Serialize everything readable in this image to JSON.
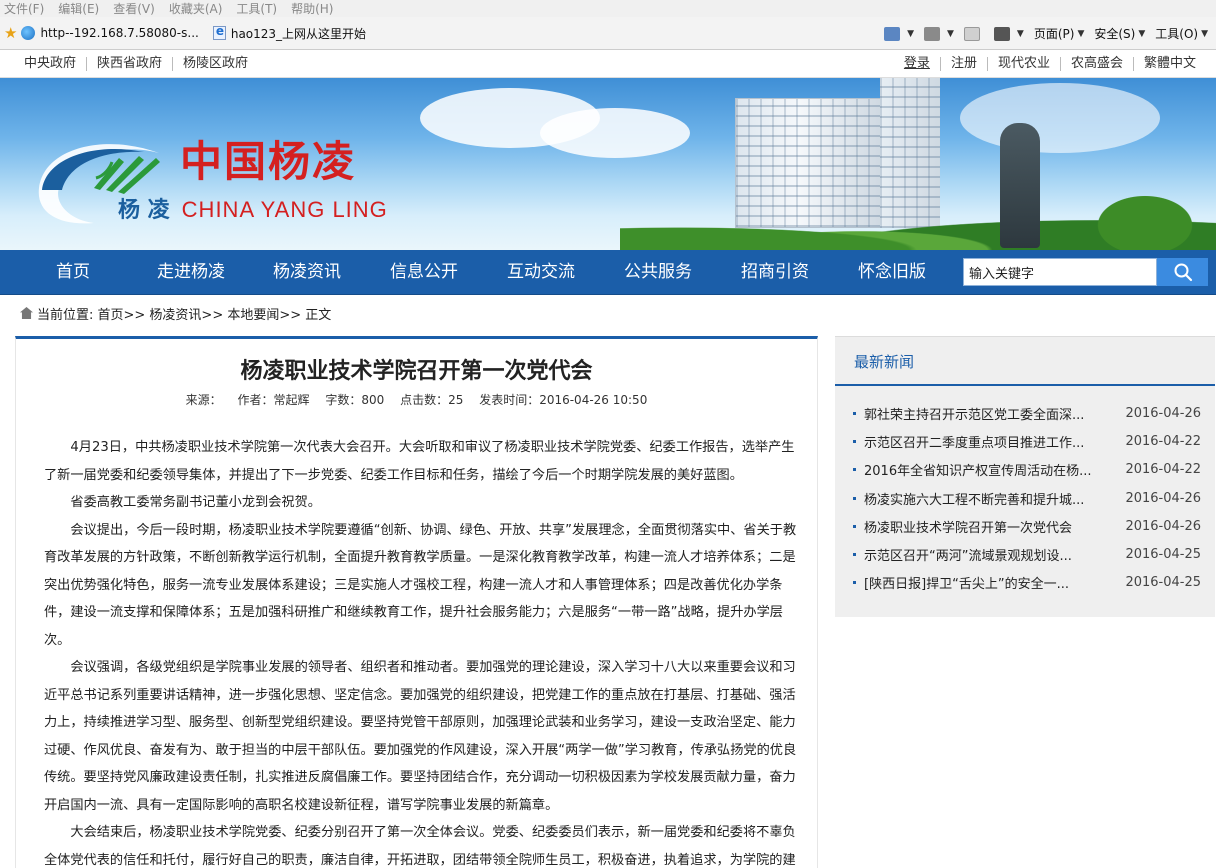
{
  "browser": {
    "menu": [
      "文件(F)",
      "编辑(E)",
      "查看(V)",
      "收藏夹(A)",
      "工具(T)",
      "帮助(H)"
    ],
    "favorites": [
      "http--192.168.7.58080-s...",
      "hao123_上网从这里开始"
    ],
    "tools": [
      "页面(P)",
      "安全(S)",
      "工具(O)"
    ]
  },
  "toplinks": {
    "left": [
      "中央政府",
      "陕西省政府",
      "杨陵区政府"
    ],
    "right": [
      "登录",
      "注册",
      "现代农业",
      "农高盛会",
      "繁體中文"
    ]
  },
  "logo": {
    "cn": "中国杨凌",
    "sub_cn": "杨 凌",
    "sub_en": "CHINA YANG LING"
  },
  "nav": [
    "首页",
    "走进杨凌",
    "杨凌资讯",
    "信息公开",
    "互动交流",
    "公共服务",
    "招商引资",
    "怀念旧版"
  ],
  "search": {
    "placeholder": "输入关键字"
  },
  "breadcrumb": "当前位置: 首页>> 杨凌资讯>> 本地要闻>> 正文",
  "article": {
    "title": "杨凌职业技术学院召开第一次党代会",
    "meta": [
      "来源：",
      "作者：常起辉",
      "字数：800",
      "点击数：25",
      "发表时间：2016-04-26 10:50"
    ],
    "paragraphs": [
      "4月23日，中共杨凌职业技术学院第一次代表大会召开。大会听取和审议了杨凌职业技术学院党委、纪委工作报告，选举产生了新一届党委和纪委领导集体，并提出了下一步党委、纪委工作目标和任务，描绘了今后一个时期学院发展的美好蓝图。",
      "省委高教工委常务副书记董小龙到会祝贺。",
      "会议提出，今后一段时期，杨凌职业技术学院要遵循“创新、协调、绿色、开放、共享”发展理念，全面贯彻落实中、省关于教育改革发展的方针政策，不断创新教学运行机制，全面提升教育教学质量。一是深化教育教学改革，构建一流人才培养体系；二是突出优势强化特色，服务一流专业发展体系建设；三是实施人才强校工程，构建一流人才和人事管理体系；四是改善优化办学条件，建设一流支撑和保障体系；五是加强科研推广和继续教育工作，提升社会服务能力；六是服务“一带一路”战略，提升办学层次。",
      "会议强调，各级党组织是学院事业发展的领导者、组织者和推动者。要加强党的理论建设，深入学习十八大以来重要会议和习近平总书记系列重要讲话精神，进一步强化思想、坚定信念。要加强党的组织建设，把党建工作的重点放在打基层、打基础、强活力上，持续推进学习型、服务型、创新型党组织建设。要坚持党管干部原则，加强理论武装和业务学习，建设一支政治坚定、能力过硬、作风优良、奋发有为、敢于担当的中层干部队伍。要加强党的作风建设，深入开展“两学一做”学习教育，传承弘扬党的优良传统。要坚持党风廉政建设责任制，扎实推进反腐倡廉工作。要坚持团结合作，充分调动一切积极因素为学校发展贡献力量，奋力开启国内一流、具有一定国际影响的高职名校建设新征程，谱写学院事业发展的新篇章。",
      "大会结束后，杨凌职业技术学院党委、纪委分别召开了第一次全体会议。党委、纪委委员们表示，新一届党委和纪委将不辜负全体党代表的信任和托付，履行好自己的职责，廉洁自律，开拓进取，团结带领全院师生员工，积极奋进，执着追求，为学院的建设和发展而不懈努力。"
    ]
  },
  "sidebar": {
    "title": "最新新闻",
    "news": [
      {
        "title": "郭社荣主持召开示范区党工委全面深...",
        "date": "2016-04-26"
      },
      {
        "title": "示范区召开二季度重点项目推进工作...",
        "date": "2016-04-22"
      },
      {
        "title": "2016年全省知识产权宣传周活动在杨...",
        "date": "2016-04-22"
      },
      {
        "title": "杨凌实施六大工程不断完善和提升城...",
        "date": "2016-04-26"
      },
      {
        "title": "杨凌职业技术学院召开第一次党代会",
        "date": "2016-04-26"
      },
      {
        "title": "示范区召开“两河”流域景观规划设...",
        "date": "2016-04-25"
      },
      {
        "title": "[陕西日报]捍卫“舌尖上”的安全一...",
        "date": "2016-04-25"
      }
    ]
  }
}
